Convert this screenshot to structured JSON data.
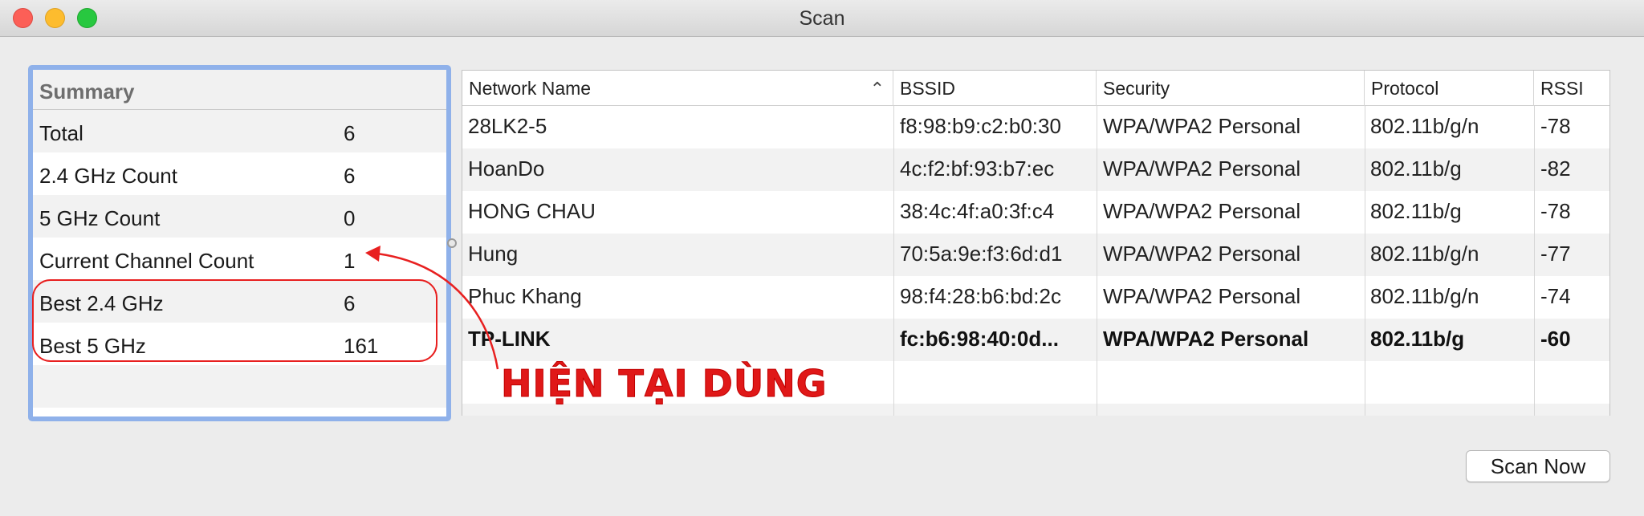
{
  "window": {
    "title": "Scan"
  },
  "summary": {
    "header": "Summary",
    "rows": [
      {
        "label": "Total",
        "value": "6"
      },
      {
        "label": "2.4 GHz Count",
        "value": "6"
      },
      {
        "label": "5 GHz Count",
        "value": "0"
      },
      {
        "label": "Current Channel Count",
        "value": "1"
      },
      {
        "label": "Best 2.4 GHz",
        "value": "6"
      },
      {
        "label": "Best 5 GHz",
        "value": "161"
      }
    ]
  },
  "networks": {
    "columns": [
      "Network Name",
      "BSSID",
      "Security",
      "Protocol",
      "RSSI"
    ],
    "sorted_by": "Network Name",
    "rows": [
      {
        "name": "28LK2-5",
        "bssid": "f8:98:b9:c2:b0:30",
        "security": "WPA/WPA2 Personal",
        "protocol": "802.11b/g/n",
        "rssi": "-78"
      },
      {
        "name": "HoanDo",
        "bssid": "4c:f2:bf:93:b7:ec",
        "security": "WPA/WPA2 Personal",
        "protocol": "802.11b/g",
        "rssi": "-82"
      },
      {
        "name": "HONG CHAU",
        "bssid": "38:4c:4f:a0:3f:c4",
        "security": "WPA/WPA2 Personal",
        "protocol": "802.11b/g",
        "rssi": "-78"
      },
      {
        "name": "Hung",
        "bssid": "70:5a:9e:f3:6d:d1",
        "security": "WPA/WPA2 Personal",
        "protocol": "802.11b/g/n",
        "rssi": "-77"
      },
      {
        "name": "Phuc Khang",
        "bssid": "98:f4:28:b6:bd:2c",
        "security": "WPA/WPA2 Personal",
        "protocol": "802.11b/g/n",
        "rssi": "-74"
      },
      {
        "name": "TP-LINK",
        "bssid": "fc:b6:98:40:0d...",
        "security": "WPA/WPA2 Personal",
        "protocol": "802.11b/g",
        "rssi": "-60"
      }
    ]
  },
  "actions": {
    "scan_now": "Scan Now"
  },
  "annotation": {
    "text": "HIỆN TẠI DÙNG",
    "color": "#e01818"
  },
  "colors": {
    "summary_border": "#8fb1ea",
    "row_alt": "#f2f2f2"
  }
}
